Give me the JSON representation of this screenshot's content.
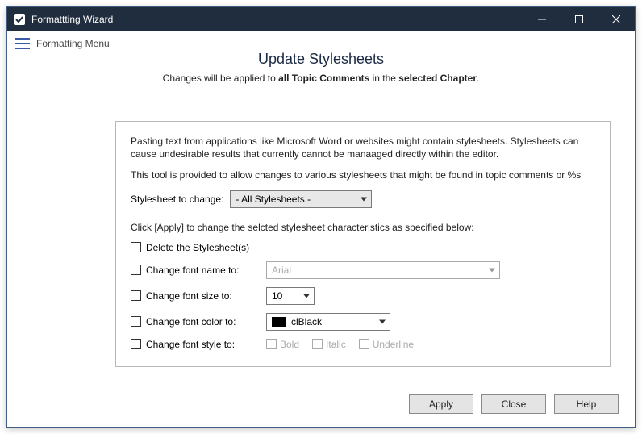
{
  "window": {
    "title": "Formattting Wizard"
  },
  "menubar": {
    "label": "Formatting Menu"
  },
  "header": {
    "title": "Update Stylesheets",
    "sub_prefix": "Changes will be applied to ",
    "sub_bold1": "all Topic Comments",
    "sub_mid": " in the ",
    "sub_bold2": "selected Chapter",
    "sub_suffix": "."
  },
  "panel": {
    "para1": "Pasting text from applications like Microsoft Word or websites might contain stylesheets. Stylesheets can cause undesirable results that currently cannot be manaaged directly within the editor.",
    "para2": "This tool is provided to allow changes to various stylesheets that might be found in topic comments or %s",
    "stylesheet_label": "Stylesheet to change:",
    "stylesheet_value": "- All Stylesheets -",
    "instruction": "Click [Apply] to change the selcted stylesheet characteristics as specified below:",
    "delete_label": "Delete the Stylesheet(s)",
    "font_name_label": "Change font name to:",
    "font_name_value": "Arial",
    "font_size_label": "Change font size to:",
    "font_size_value": "10",
    "font_color_label": "Change font color to:",
    "font_color_value": "clBlack",
    "font_style_label": "Change font style to:",
    "bold": "Bold",
    "italic": "Italic",
    "underline": "Underline"
  },
  "footer": {
    "apply": "Apply",
    "close": "Close",
    "help": "Help"
  }
}
